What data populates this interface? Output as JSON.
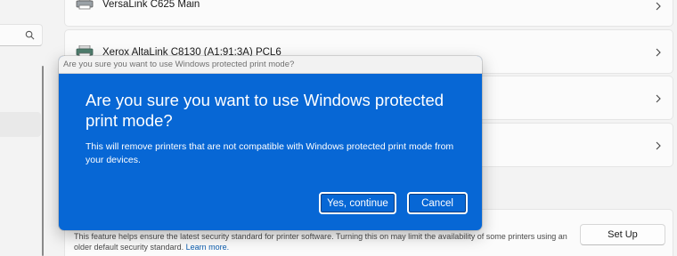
{
  "printers": [
    {
      "name": "VersaLink C625 Main",
      "icon": "printer-icon"
    },
    {
      "name": "Xerox AltaLink C8130 (A1:91:3A) PCL6",
      "icon": "printer-icon"
    },
    {
      "name": ""
    },
    {
      "name": ""
    }
  ],
  "protected_mode": {
    "description": "This feature helps ensure the latest security standard for printer software. Turning this on may limit the availability of some printers using an older default security standard.",
    "learn_more": "Learn more.",
    "setup_label": "Set Up"
  },
  "dialog": {
    "titlebar": "Are you sure you want to use Windows protected print mode?",
    "heading": "Are you sure you want to use Windows protected print mode?",
    "message": "This will remove printers that are not compatible with Windows protected print mode from your devices.",
    "confirm_label": "Yes, continue",
    "cancel_label": "Cancel"
  },
  "colors": {
    "dialog_bg": "#0767d5",
    "link": "#0b5cad"
  }
}
